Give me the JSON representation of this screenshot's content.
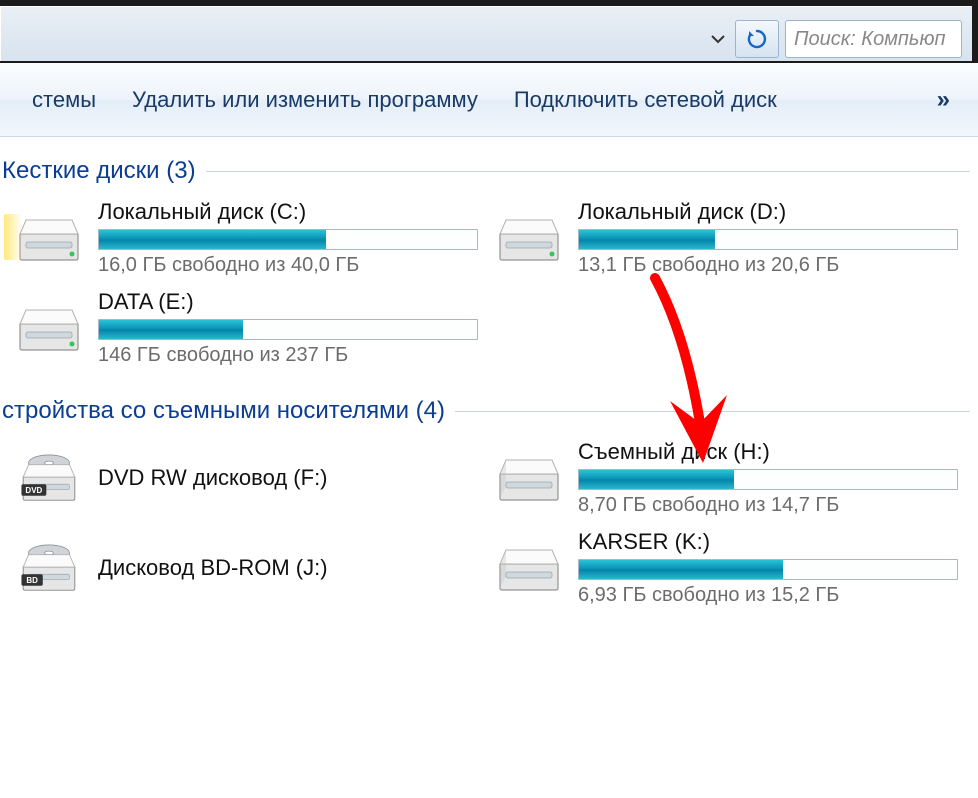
{
  "toolbar": {
    "search_placeholder": "Поиск: Компьюп"
  },
  "commandbar": {
    "items": [
      "стемы",
      "Удалить или изменить программу",
      "Подключить сетевой диск"
    ],
    "overflow_symbol": "»"
  },
  "groups": [
    {
      "title": "Кесткие диски (3)",
      "drives": [
        {
          "name": "Локальный диск (C:)",
          "free_text": "16,0 ГБ свободно из 40,0 ГБ",
          "fill_percent": 60,
          "icon": "hdd",
          "has_bar": true
        },
        {
          "name": "Локальный диск (D:)",
          "free_text": "13,1 ГБ свободно из 20,6 ГБ",
          "fill_percent": 36,
          "icon": "hdd",
          "has_bar": true
        },
        {
          "name": "DATA (E:)",
          "free_text": "146 ГБ свободно из 237 ГБ",
          "fill_percent": 38,
          "icon": "hdd",
          "has_bar": true
        }
      ]
    },
    {
      "title": "стройства со съемными носителями (4)",
      "drives": [
        {
          "name": "DVD RW дисковод (F:)",
          "free_text": "",
          "fill_percent": 0,
          "icon": "dvd",
          "badge": "DVD",
          "has_bar": false
        },
        {
          "name": "Съемный диск (H:)",
          "free_text": "8,70 ГБ свободно из 14,7 ГБ",
          "fill_percent": 41,
          "icon": "removable",
          "has_bar": true
        },
        {
          "name": "Дисковод BD-ROM (J:)",
          "free_text": "",
          "fill_percent": 0,
          "icon": "dvd",
          "badge": "BD",
          "has_bar": false
        },
        {
          "name": "KARSER (K:)",
          "free_text": "6,93 ГБ свободно из 15,2 ГБ",
          "fill_percent": 54,
          "icon": "removable",
          "has_bar": true
        }
      ]
    }
  ]
}
